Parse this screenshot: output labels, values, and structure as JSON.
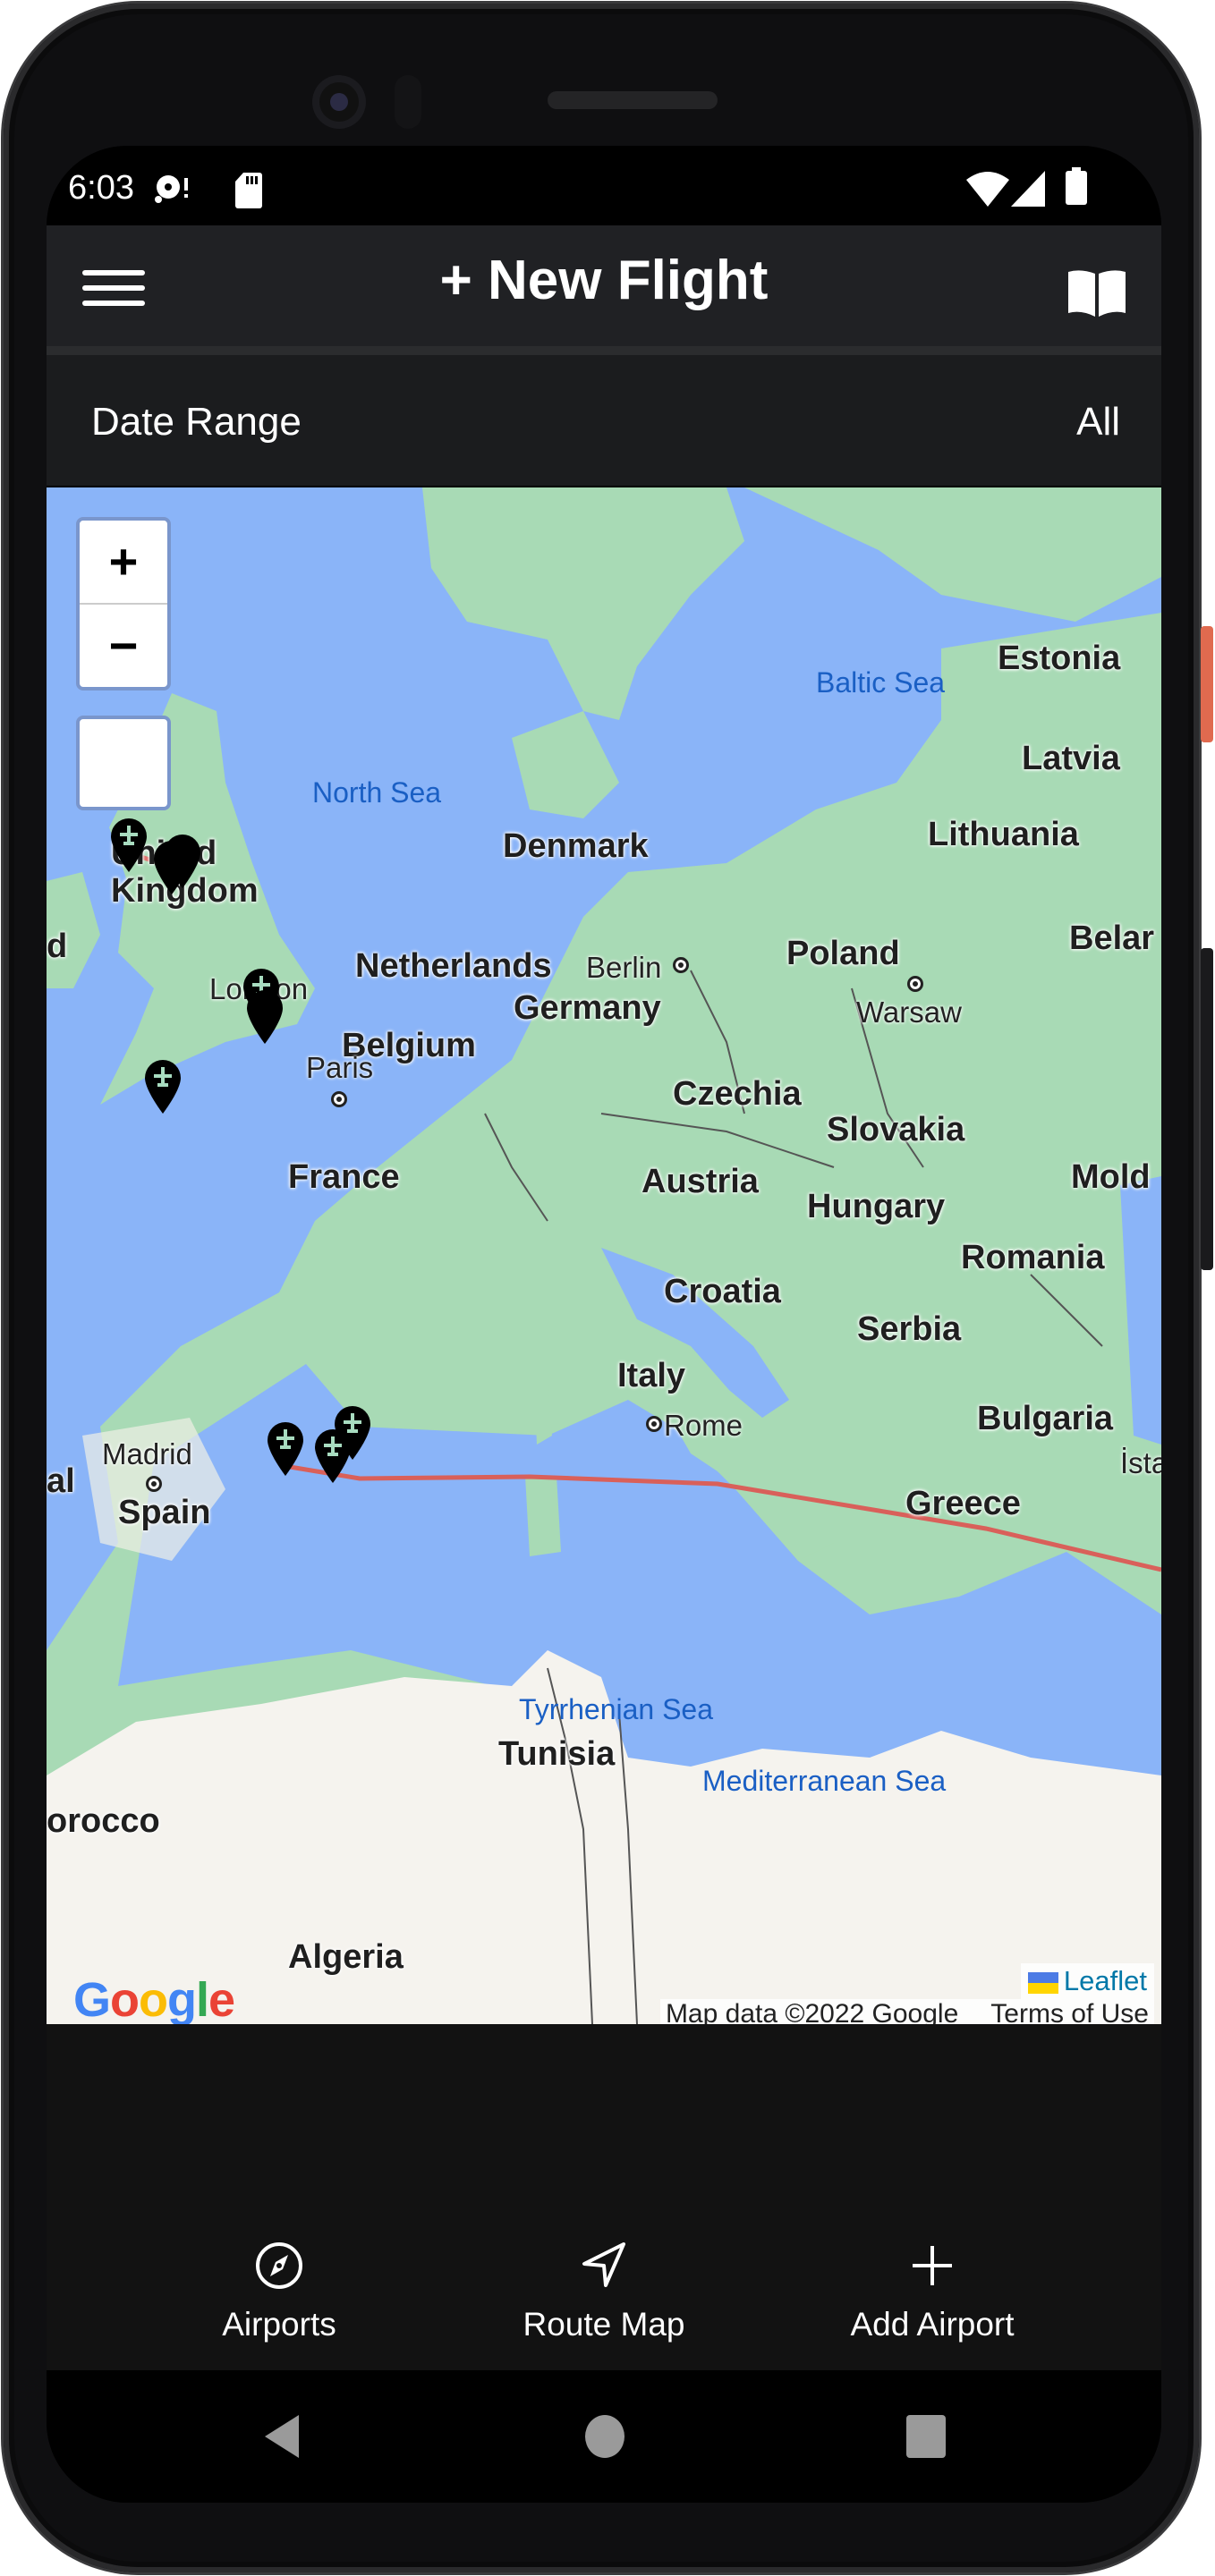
{
  "status_bar": {
    "time": "6:03",
    "left_icons": [
      "data-saver-alert-icon",
      "sd-card-icon"
    ],
    "right_icons": [
      "wifi-icon",
      "cell-signal-icon",
      "battery-icon"
    ]
  },
  "app_bar": {
    "menu_icon": "hamburger-menu-icon",
    "title": "+ New Flight",
    "action_icon": "book-open-icon"
  },
  "filter": {
    "label": "Date Range",
    "value": "All"
  },
  "map": {
    "zoom_in_label": "+",
    "zoom_out_label": "−",
    "country_labels": [
      "United Kingdom",
      "Denmark",
      "Netherlands",
      "Belgium",
      "Germany",
      "France",
      "Poland",
      "Czechia",
      "Slovakia",
      "Austria",
      "Hungary",
      "Romania",
      "Croatia",
      "Serbia",
      "Italy",
      "Bulgaria",
      "Greece",
      "Spain",
      "Tunisia",
      "Algeria",
      "Estonia",
      "Latvia",
      "Lithuania",
      "Belarus",
      "Moldova",
      "Morocco",
      "Portugal",
      "Ireland"
    ],
    "labels": {
      "uk": "United\nKingdom",
      "denmark": "Denmark",
      "netherlands": "Netherlands",
      "belgium": "Belgium",
      "germany": "Germany",
      "france": "France",
      "poland": "Poland",
      "czechia": "Czechia",
      "slovakia": "Slovakia",
      "austria": "Austria",
      "hungary": "Hungary",
      "romania": "Romania",
      "croatia": "Croatia",
      "serbia": "Serbia",
      "italy": "Italy",
      "bulgaria": "Bulgaria",
      "greece": "Greece",
      "spain": "Spain",
      "tunisia": "Tunisia",
      "algeria": "Algeria",
      "estonia": "Estonia",
      "latvia": "Latvia",
      "lithuania": "Lithuania",
      "belarus": "Belar",
      "moldova": "Mold",
      "morocco": "orocco",
      "portugal": "al",
      "ireland": "d"
    },
    "cities": {
      "london": "London",
      "paris": "Paris",
      "berlin": "Berlin",
      "warsaw": "Warsaw",
      "rome": "Rome",
      "madrid": "Madrid",
      "istanbul": "İstar"
    },
    "seas": {
      "north_sea": "North Sea",
      "baltic_sea": "Baltic Sea",
      "tyrrhenian_sea": "Tyrrhenian Sea",
      "mediterranean_sea": "Mediterranean Sea"
    },
    "markers": [
      {
        "name": "Glasgow area airport",
        "icon": "airplane-pin-icon"
      },
      {
        "name": "Edinburgh area airport",
        "icon": "airplane-pin-icon"
      },
      {
        "name": "London airport 1",
        "icon": "airplane-pin-icon"
      },
      {
        "name": "London airport 2",
        "icon": "airplane-pin-icon"
      },
      {
        "name": "Cornwall/Bristol airport",
        "icon": "airplane-pin-icon"
      },
      {
        "name": "Spain inland airport",
        "icon": "airplane-pin-icon"
      },
      {
        "name": "Barcelona airport 1",
        "icon": "airplane-pin-icon"
      },
      {
        "name": "Barcelona airport 2",
        "icon": "airplane-pin-icon"
      }
    ],
    "route_color": "#d9605a",
    "marker_color": "#000000",
    "marker_glyph_color": "#a8dcc0",
    "attribution_leaflet": "Leaflet",
    "attribution_data": "Map data ©2022 Google",
    "terms": "Terms of Use",
    "google_logo": "Google"
  },
  "bottom_nav": [
    {
      "label": "Airports",
      "icon": "compass-icon"
    },
    {
      "label": "Route Map",
      "icon": "navigation-arrow-icon"
    },
    {
      "label": "Add Airport",
      "icon": "plus-icon"
    }
  ],
  "system_nav": [
    "back-icon",
    "home-icon",
    "recents-icon"
  ],
  "colors": {
    "app_bar": "#202124",
    "filter_bar": "#1b1c1e",
    "bottom_nav": "#121212",
    "water": "#8ab4f8",
    "land": "#a8dab5",
    "desert": "#f5f3ee",
    "accent_power_button": "#e06a4f"
  }
}
